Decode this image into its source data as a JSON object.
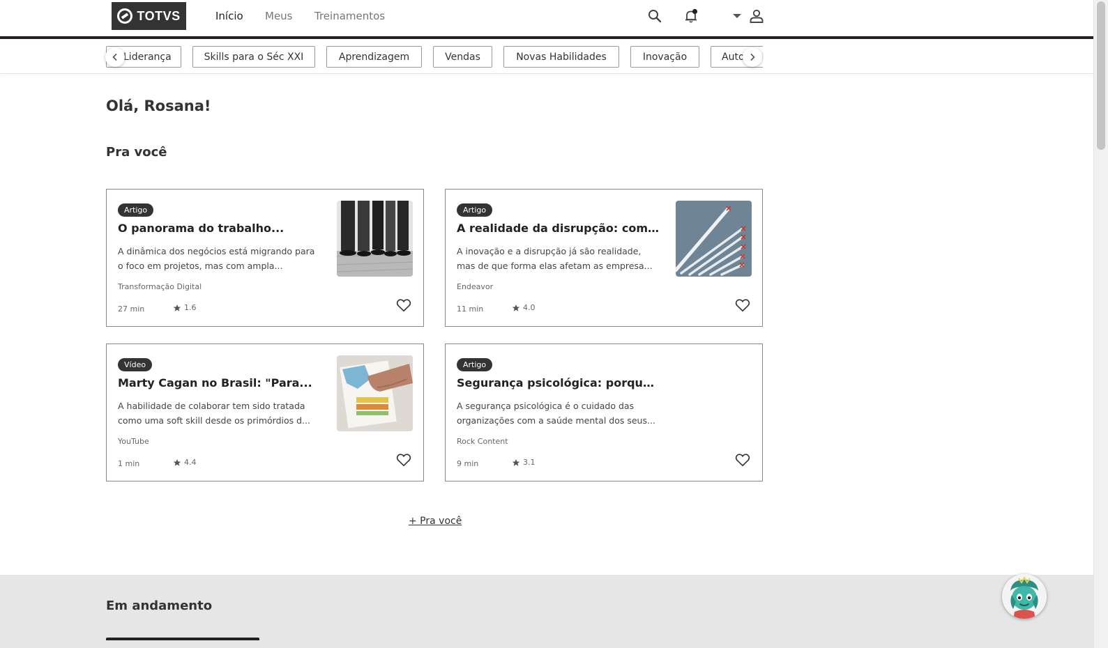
{
  "brand": {
    "name": "TOTVS"
  },
  "nav": {
    "items": [
      {
        "label": "Início",
        "active": true
      },
      {
        "label": "Meus",
        "active": false
      },
      {
        "label": "Treinamentos",
        "active": false
      }
    ]
  },
  "header_icons": {
    "search": "search-icon",
    "notifications": "bell-icon",
    "menu": "caret-down-icon",
    "profile": "user-icon"
  },
  "categories": {
    "items": [
      "Liderança",
      "Skills para o Séc XXI",
      "Aprendizagem",
      "Vendas",
      "Novas Habilidades",
      "Inovação",
      "Autoconhecimento"
    ]
  },
  "greeting": "Olá, Rosana!",
  "for_you": {
    "title": "Pra você",
    "more_label": "+ Pra você",
    "cards": [
      {
        "type": "Artigo",
        "title": "O panorama do trabalho...",
        "description": "A dinâmica dos negócios está migrando para o foco em projetos, mas com ampla...",
        "source": "Transformação Digital",
        "duration": "27 min",
        "rating": "1.6",
        "image": "people-feet-photo"
      },
      {
        "type": "Artigo",
        "title": "A realidade da disrupção: como ...",
        "description": "A inovação e a disrupção já são realidade, mas de que forma elas afetam as empresa...",
        "source": "Endeavor",
        "duration": "11 min",
        "rating": "4.0",
        "image": "jets-formation-photo"
      },
      {
        "type": "Vídeo",
        "title": "Marty Cagan no Brasil: \"Para...",
        "description": "A habilidade de colaborar tem sido tratada como uma soft skill desde os primórdios d...",
        "source": "YouTube",
        "duration": "1 min",
        "rating": "4.4",
        "image": "documents-hands-photo"
      },
      {
        "type": "Artigo",
        "title": "Segurança psicológica: porque é...",
        "description": "A segurança psicológica é o cuidado das organizações com a saúde mental dos seus...",
        "source": "Rock Content",
        "duration": "9 min",
        "rating": "3.1",
        "image": null
      }
    ]
  },
  "in_progress": {
    "title": "Em andamento"
  },
  "colors": {
    "brand_dark": "#333333",
    "header_rule": "#2a1f1f",
    "section_bg": "#e6e6e6",
    "assistant_accent": "#3fb8a8"
  }
}
